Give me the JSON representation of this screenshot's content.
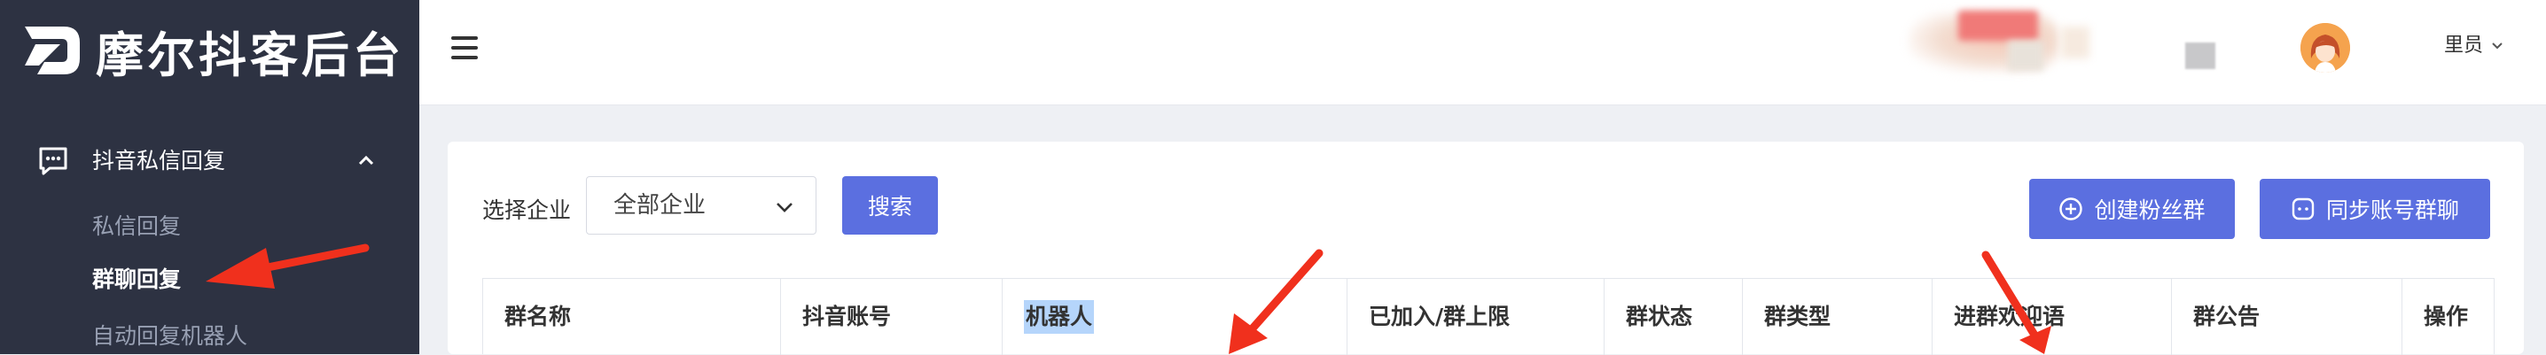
{
  "app": {
    "title": "摩尔抖客后台"
  },
  "sidebar": {
    "group": {
      "label": "抖音私信回复",
      "icon": "chat-bubble-icon",
      "expanded": true
    },
    "items": [
      {
        "label": "私信回复",
        "active": false
      },
      {
        "label": "群聊回复",
        "active": true
      },
      {
        "label": "自动回复机器人",
        "active": false
      }
    ]
  },
  "header": {
    "menu_icon": "hamburger-icon",
    "user": {
      "name": "里员",
      "avatar_icon": "user-avatar-icon"
    }
  },
  "filters": {
    "company_label": "选择企业",
    "company_value": "全部企业",
    "search_label": "搜索"
  },
  "actions": {
    "create_label": "创建粉丝群",
    "create_icon": "plus-circle-icon",
    "sync_label": "同步账号群聊",
    "sync_icon": "chat-dots-icon"
  },
  "table": {
    "columns": [
      "群名称",
      "抖音账号",
      "机器人",
      "已加入/群上限",
      "群状态",
      "群类型",
      "进群欢迎语",
      "群公告",
      "操作"
    ],
    "highlighted_column": "机器人"
  },
  "colors": {
    "sidebar_bg": "#2d3242",
    "primary": "#5b6fe0",
    "annotation_arrow": "#f0301d",
    "page_bg": "#eef0f4"
  }
}
